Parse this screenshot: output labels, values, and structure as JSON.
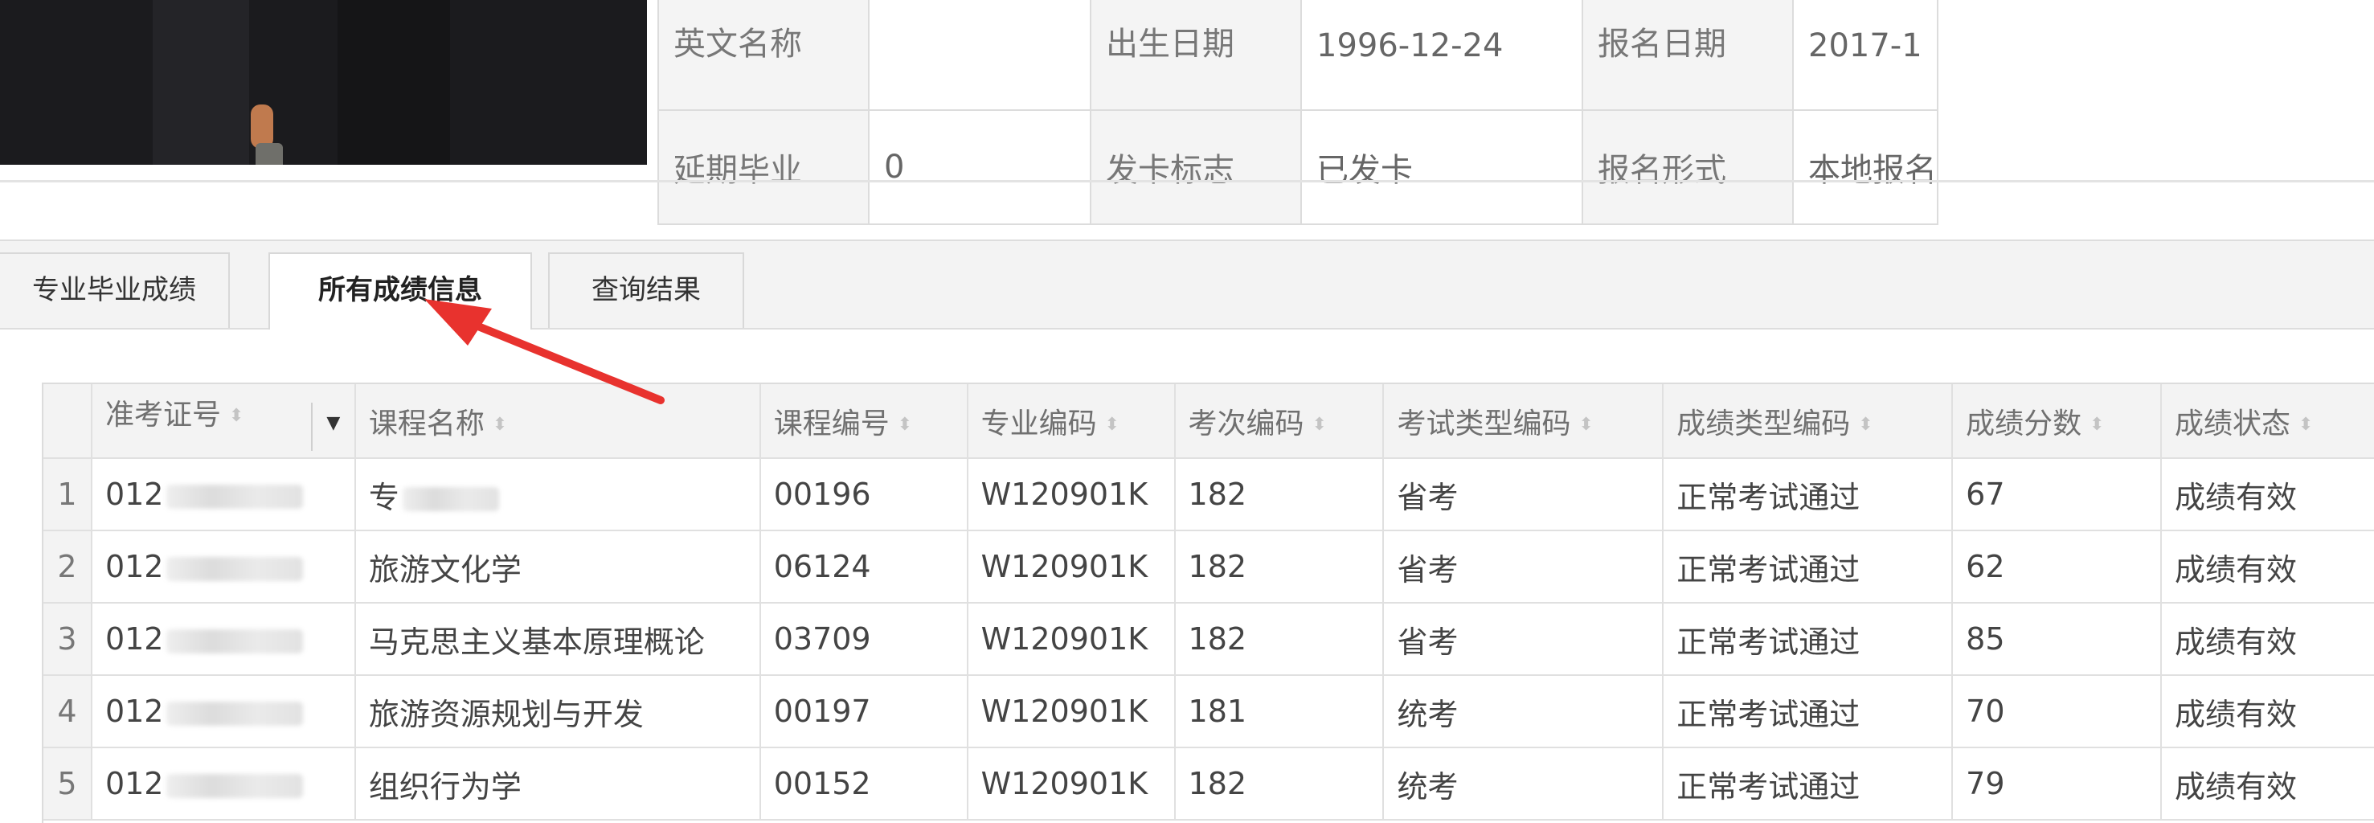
{
  "info": {
    "rows": [
      [
        {
          "label": "英文名称",
          "value": ""
        },
        {
          "label": "出生日期",
          "value": "1996-12-24"
        },
        {
          "label": "报名日期",
          "value": "2017-1"
        }
      ],
      [
        {
          "label": "延期毕业",
          "value": "0"
        },
        {
          "label": "发卡标志",
          "value": "已发卡"
        },
        {
          "label": "报名形式",
          "value": "本地报名"
        }
      ]
    ]
  },
  "tabs": [
    {
      "label": "专业毕业成绩",
      "active": false
    },
    {
      "label": "所有成绩信息",
      "active": true
    },
    {
      "label": "查询结果",
      "active": false
    }
  ],
  "grid": {
    "columns": [
      "准考证号",
      "课程名称",
      "课程编号",
      "专业编码",
      "考次编码",
      "考试类型编码",
      "成绩类型编码",
      "成绩分数",
      "成绩状态"
    ],
    "rows": [
      {
        "n": "1",
        "ticket": "012",
        "course": "专",
        "code": "00196",
        "major": "W120901K",
        "session": "182",
        "type": "省考",
        "result_type": "正常考试通过",
        "score": "67",
        "status": "成绩有效"
      },
      {
        "n": "2",
        "ticket": "012",
        "course": "旅游文化学",
        "code": "06124",
        "major": "W120901K",
        "session": "182",
        "type": "省考",
        "result_type": "正常考试通过",
        "score": "62",
        "status": "成绩有效"
      },
      {
        "n": "3",
        "ticket": "012",
        "course": "马克思主义基本原理概论",
        "code": "03709",
        "major": "W120901K",
        "session": "182",
        "type": "省考",
        "result_type": "正常考试通过",
        "score": "85",
        "status": "成绩有效"
      },
      {
        "n": "4",
        "ticket": "012",
        "course": "旅游资源规划与开发",
        "code": "00197",
        "major": "W120901K",
        "session": "181",
        "type": "统考",
        "result_type": "正常考试通过",
        "score": "70",
        "status": "成绩有效"
      },
      {
        "n": "5",
        "ticket": "012",
        "course": "组织行为学",
        "code": "00152",
        "major": "W120901K",
        "session": "182",
        "type": "统考",
        "result_type": "正常考试通过",
        "score": "79",
        "status": "成绩有效"
      }
    ]
  },
  "colors": {
    "arrow": "#e8322e",
    "header_bg": "#f3f3f3",
    "border": "#dcdcdc"
  }
}
